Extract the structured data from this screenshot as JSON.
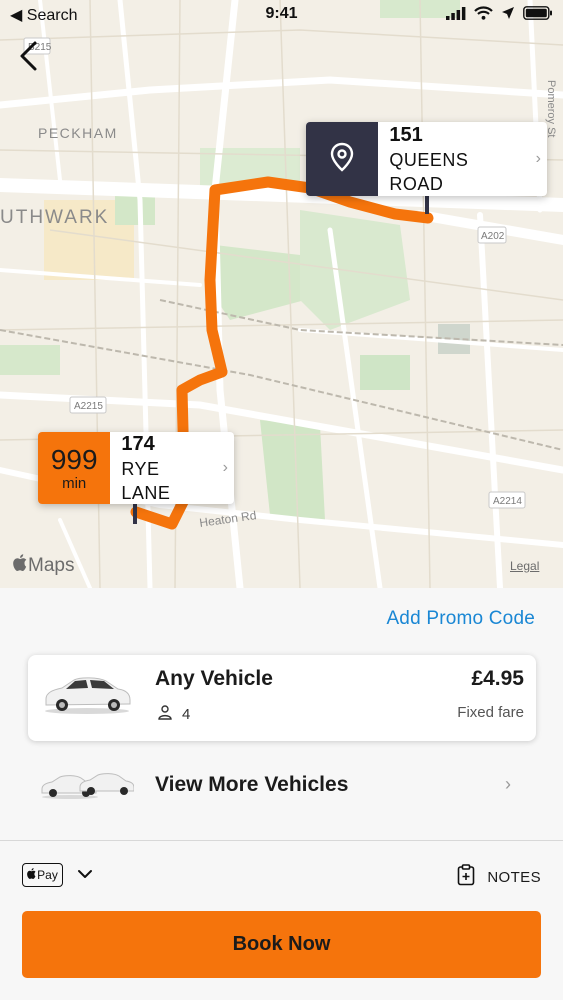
{
  "status_bar": {
    "back_app": "Search",
    "time": "9:41"
  },
  "map": {
    "labels": {
      "peckham": "PECKHAM",
      "southwark": "UTHWARK",
      "heaton_rd": "Heaton Rd",
      "pomeroy_st": "Pomeroy St"
    },
    "road_badges": [
      "B215",
      "A202",
      "A2215",
      "A2214",
      "A202"
    ],
    "destination": {
      "number": "151",
      "street": "QUEENS ROAD",
      "icon": "location-pin-icon"
    },
    "origin": {
      "eta_value": "999",
      "eta_unit": "min",
      "number": "174",
      "street": "RYE LANE"
    },
    "maps_logo": "Maps",
    "legal": "Legal",
    "route_color": "#f5740c"
  },
  "booking": {
    "promo_link": "Add Promo Code",
    "vehicle": {
      "name": "Any Vehicle",
      "seats": "4",
      "price": "£4.95",
      "fare_type": "Fixed fare"
    },
    "more_vehicles": "View More Vehicles",
    "payment": {
      "method": "Pay"
    },
    "notes_label": "NOTES",
    "book_button": "Book Now"
  },
  "colors": {
    "accent": "#f5740c",
    "link": "#1a87d4",
    "dark_pin": "#323346"
  }
}
